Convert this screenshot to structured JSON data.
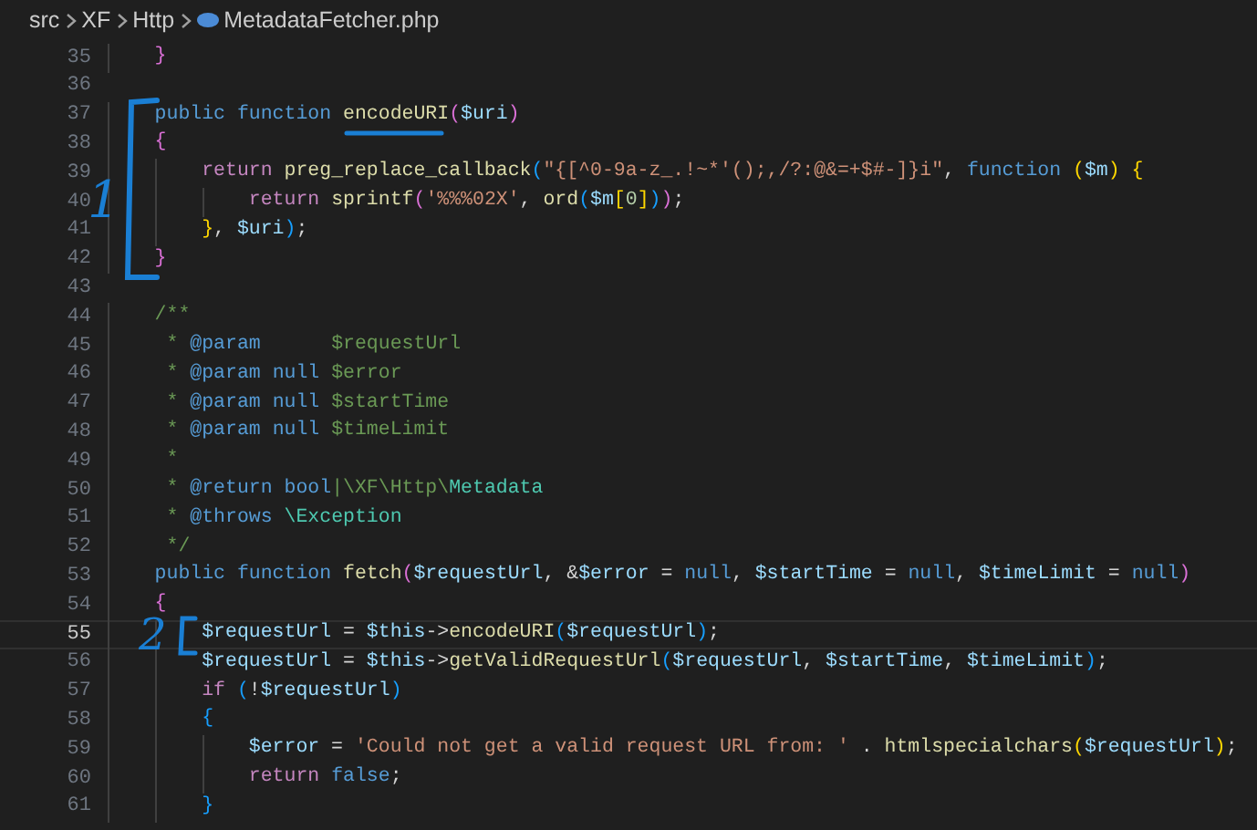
{
  "breadcrumb": {
    "segments": [
      "src",
      "XF",
      "Http"
    ],
    "file": "MetadataFetcher.php"
  },
  "editor": {
    "lines": [
      {
        "number": "35",
        "current": false,
        "tokens": [
          {
            "kind": "b2",
            "text": "    }"
          }
        ]
      },
      {
        "number": "36",
        "current": false
      },
      {
        "number": "37",
        "current": false,
        "tokens": [
          {
            "kind": "kw",
            "text": "    public function "
          },
          {
            "kind": "fn",
            "text": "encodeURI"
          },
          {
            "kind": "b2",
            "text": "("
          },
          {
            "kind": "var",
            "text": "$uri"
          },
          {
            "kind": "b2",
            "text": ")"
          }
        ]
      },
      {
        "number": "38",
        "current": false,
        "tokens": [
          {
            "kind": "b2",
            "text": "    {"
          }
        ]
      },
      {
        "number": "39",
        "current": false,
        "tokens": [
          {
            "kind": "ctrl",
            "text": "        return "
          },
          {
            "kind": "fn",
            "text": "preg_replace_callback"
          },
          {
            "kind": "b3",
            "text": "("
          },
          {
            "kind": "str",
            "text": "\"{[^0-9a-z_.!~*'();,/?:@&=+$#-]}i\""
          },
          {
            "kind": "op",
            "text": ", "
          },
          {
            "kind": "kw",
            "text": "function "
          },
          {
            "kind": "b1",
            "text": "("
          },
          {
            "kind": "var",
            "text": "$m"
          },
          {
            "kind": "b1",
            "text": ")"
          },
          {
            "kind": "b1",
            "text": " {"
          }
        ]
      },
      {
        "number": "40",
        "current": false,
        "tokens": [
          {
            "kind": "ctrl",
            "text": "            return "
          },
          {
            "kind": "fn",
            "text": "sprintf"
          },
          {
            "kind": "b2",
            "text": "("
          },
          {
            "kind": "str",
            "text": "'%%%02X'"
          },
          {
            "kind": "op",
            "text": ", "
          },
          {
            "kind": "fn",
            "text": "ord"
          },
          {
            "kind": "b3",
            "text": "("
          },
          {
            "kind": "var",
            "text": "$m"
          },
          {
            "kind": "b1",
            "text": "["
          },
          {
            "kind": "num",
            "text": "0"
          },
          {
            "kind": "b1",
            "text": "]"
          },
          {
            "kind": "b3",
            "text": ")"
          },
          {
            "kind": "b2",
            "text": ")"
          },
          {
            "kind": "op",
            "text": ";"
          }
        ]
      },
      {
        "number": "41",
        "current": false,
        "tokens": [
          {
            "kind": "b1",
            "text": "        }"
          },
          {
            "kind": "op",
            "text": ", "
          },
          {
            "kind": "var",
            "text": "$uri"
          },
          {
            "kind": "b3",
            "text": ")"
          },
          {
            "kind": "op",
            "text": ";"
          }
        ]
      },
      {
        "number": "42",
        "current": false,
        "tokens": [
          {
            "kind": "b2",
            "text": "    }"
          }
        ]
      },
      {
        "number": "43",
        "current": false
      },
      {
        "number": "44",
        "current": false,
        "tokens": [
          {
            "kind": "com",
            "text": "    /**"
          }
        ]
      },
      {
        "number": "45",
        "current": false,
        "tokens": [
          {
            "kind": "com",
            "text": "     * "
          },
          {
            "kind": "tag",
            "text": "@param"
          },
          {
            "kind": "com",
            "text": "      $requestUrl"
          }
        ]
      },
      {
        "number": "46",
        "current": false,
        "tokens": [
          {
            "kind": "com",
            "text": "     * "
          },
          {
            "kind": "tag",
            "text": "@param null "
          },
          {
            "kind": "com",
            "text": "$error"
          }
        ]
      },
      {
        "number": "47",
        "current": false,
        "tokens": [
          {
            "kind": "com",
            "text": "     * "
          },
          {
            "kind": "tag",
            "text": "@param null "
          },
          {
            "kind": "com",
            "text": "$startTime"
          }
        ]
      },
      {
        "number": "48",
        "current": false,
        "tokens": [
          {
            "kind": "com",
            "text": "     * "
          },
          {
            "kind": "tag",
            "text": "@param null "
          },
          {
            "kind": "com",
            "text": "$timeLimit"
          }
        ]
      },
      {
        "number": "49",
        "current": false,
        "tokens": [
          {
            "kind": "com",
            "text": "     *"
          }
        ]
      },
      {
        "number": "50",
        "current": false,
        "tokens": [
          {
            "kind": "com",
            "text": "     * "
          },
          {
            "kind": "tag",
            "text": "@return bool"
          },
          {
            "kind": "com",
            "text": "|\\XF\\Http\\"
          },
          {
            "kind": "type",
            "text": "Metadata"
          }
        ]
      },
      {
        "number": "51",
        "current": false,
        "tokens": [
          {
            "kind": "com",
            "text": "     * "
          },
          {
            "kind": "tag",
            "text": "@throws "
          },
          {
            "kind": "type",
            "text": "\\Exception"
          }
        ]
      },
      {
        "number": "52",
        "current": false,
        "tokens": [
          {
            "kind": "com",
            "text": "     */"
          }
        ]
      },
      {
        "number": "53",
        "current": false,
        "tokens": [
          {
            "kind": "kw",
            "text": "    public function "
          },
          {
            "kind": "fn",
            "text": "fetch"
          },
          {
            "kind": "b2",
            "text": "("
          },
          {
            "kind": "var",
            "text": "$requestUrl"
          },
          {
            "kind": "op",
            "text": ", &"
          },
          {
            "kind": "var",
            "text": "$error"
          },
          {
            "kind": "op",
            "text": " = "
          },
          {
            "kind": "kw",
            "text": "null"
          },
          {
            "kind": "op",
            "text": ", "
          },
          {
            "kind": "var",
            "text": "$startTime"
          },
          {
            "kind": "op",
            "text": " = "
          },
          {
            "kind": "kw",
            "text": "null"
          },
          {
            "kind": "op",
            "text": ", "
          },
          {
            "kind": "var",
            "text": "$timeLimit"
          },
          {
            "kind": "op",
            "text": " = "
          },
          {
            "kind": "kw",
            "text": "null"
          },
          {
            "kind": "b2",
            "text": ")"
          }
        ]
      },
      {
        "number": "54",
        "current": false,
        "tokens": [
          {
            "kind": "b2",
            "text": "    {"
          }
        ]
      },
      {
        "number": "55",
        "current": true,
        "tokens": [
          {
            "kind": "var",
            "text": "        $requestUrl"
          },
          {
            "kind": "op",
            "text": " = "
          },
          {
            "kind": "var",
            "text": "$this"
          },
          {
            "kind": "op",
            "text": "->"
          },
          {
            "kind": "fn",
            "text": "encodeURI"
          },
          {
            "kind": "b3",
            "text": "("
          },
          {
            "kind": "var",
            "text": "$requestUrl"
          },
          {
            "kind": "b3",
            "text": ")"
          },
          {
            "kind": "op",
            "text": ";"
          }
        ]
      },
      {
        "number": "56",
        "current": false,
        "tokens": [
          {
            "kind": "var",
            "text": "        $requestUrl"
          },
          {
            "kind": "op",
            "text": " = "
          },
          {
            "kind": "var",
            "text": "$this"
          },
          {
            "kind": "op",
            "text": "->"
          },
          {
            "kind": "fn",
            "text": "getValidRequestUrl"
          },
          {
            "kind": "b3",
            "text": "("
          },
          {
            "kind": "var",
            "text": "$requestUrl"
          },
          {
            "kind": "op",
            "text": ", "
          },
          {
            "kind": "var",
            "text": "$startTime"
          },
          {
            "kind": "op",
            "text": ", "
          },
          {
            "kind": "var",
            "text": "$timeLimit"
          },
          {
            "kind": "b3",
            "text": ")"
          },
          {
            "kind": "op",
            "text": ";"
          }
        ]
      },
      {
        "number": "57",
        "current": false,
        "tokens": [
          {
            "kind": "ctrl",
            "text": "        if "
          },
          {
            "kind": "b3",
            "text": "("
          },
          {
            "kind": "op",
            "text": "!"
          },
          {
            "kind": "var",
            "text": "$requestUrl"
          },
          {
            "kind": "b3",
            "text": ")"
          }
        ]
      },
      {
        "number": "58",
        "current": false,
        "tokens": [
          {
            "kind": "b3",
            "text": "        {"
          }
        ]
      },
      {
        "number": "59",
        "current": false,
        "tokens": [
          {
            "kind": "var",
            "text": "            $error"
          },
          {
            "kind": "op",
            "text": " = "
          },
          {
            "kind": "str",
            "text": "'Could not get a valid request URL from: '"
          },
          {
            "kind": "op",
            "text": " . "
          },
          {
            "kind": "fn",
            "text": "htmlspecialchars"
          },
          {
            "kind": "b1",
            "text": "("
          },
          {
            "kind": "var",
            "text": "$requestUrl"
          },
          {
            "kind": "b1",
            "text": ")"
          },
          {
            "kind": "op",
            "text": ";"
          }
        ]
      },
      {
        "number": "60",
        "current": false,
        "tokens": [
          {
            "kind": "ctrl",
            "text": "            return "
          },
          {
            "kind": "kw",
            "text": "false"
          },
          {
            "kind": "op",
            "text": ";"
          }
        ]
      },
      {
        "number": "61",
        "current": false,
        "tokens": [
          {
            "kind": "b3",
            "text": "        }"
          }
        ]
      }
    ]
  },
  "annotations": [
    {
      "label": "1"
    },
    {
      "label": "2"
    }
  ]
}
